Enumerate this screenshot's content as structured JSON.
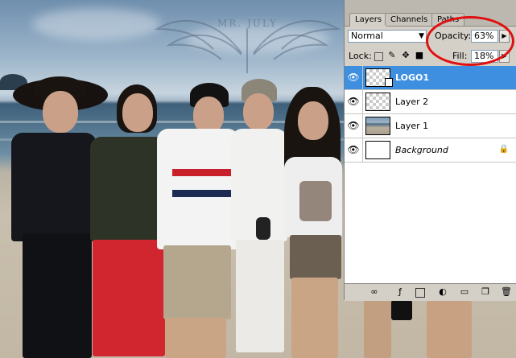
{
  "panel": {
    "tabs": [
      {
        "label": "Layers",
        "active": true
      },
      {
        "label": "Channels",
        "active": false
      },
      {
        "label": "Paths",
        "active": false
      }
    ],
    "blend_mode": "Normal",
    "opacity_label": "Opacity:",
    "opacity_value": "63%",
    "lock_label": "Lock:",
    "fill_label": "Fill:",
    "fill_value": "18%",
    "layers": [
      {
        "name": "LOGO1",
        "selected": true,
        "visible": true,
        "thumb": "transparent-linked"
      },
      {
        "name": "Layer 2",
        "selected": false,
        "visible": true,
        "thumb": "transparent"
      },
      {
        "name": "Layer 1",
        "selected": false,
        "visible": true,
        "thumb": "photo"
      },
      {
        "name": "Background",
        "selected": false,
        "visible": true,
        "thumb": "white",
        "locked": true
      }
    ]
  },
  "watermark": {
    "text": "MR. JULY"
  },
  "colors": {
    "selection": "#3e8fe0",
    "highlight_ring": "#e01010",
    "panel_bg": "#d4d0c8"
  }
}
